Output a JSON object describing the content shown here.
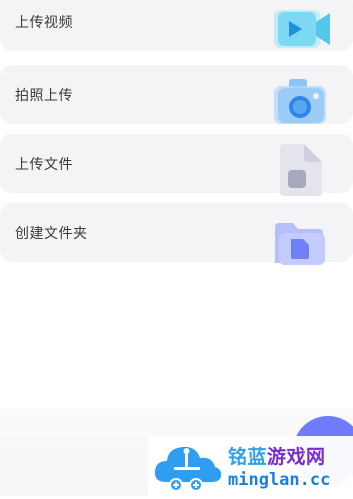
{
  "menu": {
    "items": [
      {
        "label": "上传视频",
        "icon": "video-camera-icon"
      },
      {
        "label": "拍照上传",
        "icon": "camera-icon"
      },
      {
        "label": "上传文件",
        "icon": "file-icon"
      },
      {
        "label": "创建文件夹",
        "icon": "folder-icon"
      }
    ]
  },
  "watermark": {
    "title_a": "铭蓝",
    "title_b": "游戏网",
    "url": "minglan.cc"
  },
  "colors": {
    "item_background": "#f4f4f6",
    "video_icon": "#66d1f0",
    "camera_icon": "#7fb7f5",
    "file_icon": "#c9c9d6",
    "folder_icon": "#7f93f7",
    "fab": "#6f7cfb"
  }
}
